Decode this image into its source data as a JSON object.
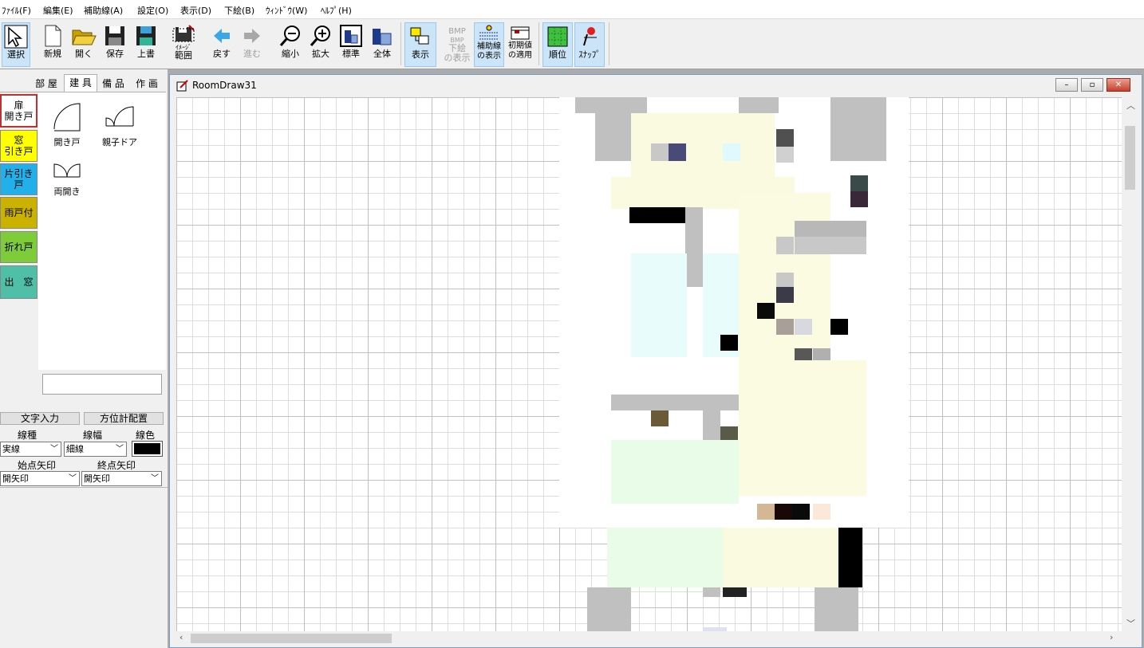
{
  "menu": [
    "ﾌｧｲﾙ(F)",
    "編集(E)",
    "補助線(A)",
    "設定(O)",
    "表示(D)",
    "下絵(B)",
    "ｳｨﾝﾄﾞｳ(W)",
    "ﾍﾙﾌﾟ(H)"
  ],
  "toolbar": {
    "select": "選択",
    "new": "新規",
    "open": "開く",
    "save": "保存",
    "overwrite": "上書",
    "image_range_small": "ｲﾒｰｼﾞ",
    "image_range": "範囲",
    "undo": "戻す",
    "redo": "進む",
    "zoom_out": "縮小",
    "zoom_in": "拡大",
    "standard": "標準",
    "whole": "全体",
    "display": "表示",
    "bmp_top": "BMP",
    "bmp_sub": "BMP",
    "underlay_1": "下絵",
    "underlay_2": "の表示",
    "guide_1": "補助線",
    "guide_2": "の表示",
    "init_1": "初期値",
    "init_2": "の適用",
    "order": "順位",
    "snap": "ｽﾅｯﾌﾟ"
  },
  "tabs": [
    "部 屋",
    "建 具",
    "備 品",
    "作 画"
  ],
  "categories": [
    {
      "line1": "扉",
      "line2": "開き戸",
      "color": "#ffffff"
    },
    {
      "line1": "窓",
      "line2": "引き戸",
      "color": "#ffff00"
    },
    {
      "line1": "片引き戸",
      "line2": "",
      "color": "#22b0ea"
    },
    {
      "line1": "雨戸付",
      "line2": "",
      "color": "#ccb200"
    },
    {
      "line1": "折れ戸",
      "line2": "",
      "color": "#7fcc3a"
    },
    {
      "line1": "出　窓",
      "line2": "",
      "color": "#4fbfa8"
    }
  ],
  "items": [
    "開き戸",
    "親子ドア",
    "両開き"
  ],
  "panel": {
    "text_input": "文字入力",
    "compass": "方位計配置",
    "line_type_label": "線種",
    "line_width_label": "線幅",
    "line_color_label": "線色",
    "line_type": "実線",
    "line_width": "細線",
    "start_arrow_label": "始点矢印",
    "end_arrow_label": "終点矢印",
    "start_arrow": "開矢印",
    "end_arrow": "開矢印"
  },
  "window": {
    "title": "RoomDraw31",
    "min": "–",
    "max": "▫",
    "close": "✕"
  }
}
